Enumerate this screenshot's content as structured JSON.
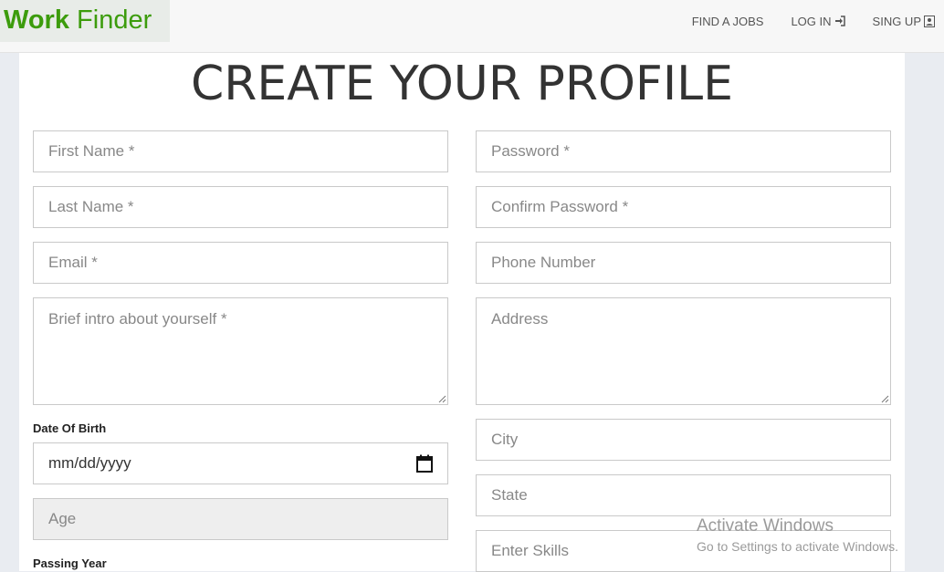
{
  "brand": {
    "part1": "Work",
    "part2": "Finder"
  },
  "nav": {
    "find_jobs": "FIND A JOBS",
    "login": "LOG IN",
    "signup": "SING UP"
  },
  "page_title": "CREATE YOUR PROFILE",
  "form": {
    "first_name": "First Name *",
    "last_name": "Last Name *",
    "email": "Email *",
    "intro": "Brief intro about yourself *",
    "dob_label": "Date Of Birth",
    "dob_value": "mm/dd/yyyy",
    "age": "Age",
    "passing_year_label": "Passing Year",
    "password": "Password *",
    "confirm_password": "Confirm Password *",
    "phone": "Phone Number",
    "address": "Address",
    "city": "City",
    "state": "State",
    "skills": "Enter Skills"
  },
  "watermark": {
    "line1": "Activate Windows",
    "line2": "Go to Settings to activate Windows."
  },
  "colors": {
    "brand": "#3c9c0c",
    "navbar": "#f7f7f7",
    "page_bg": "#e9ecf1"
  }
}
